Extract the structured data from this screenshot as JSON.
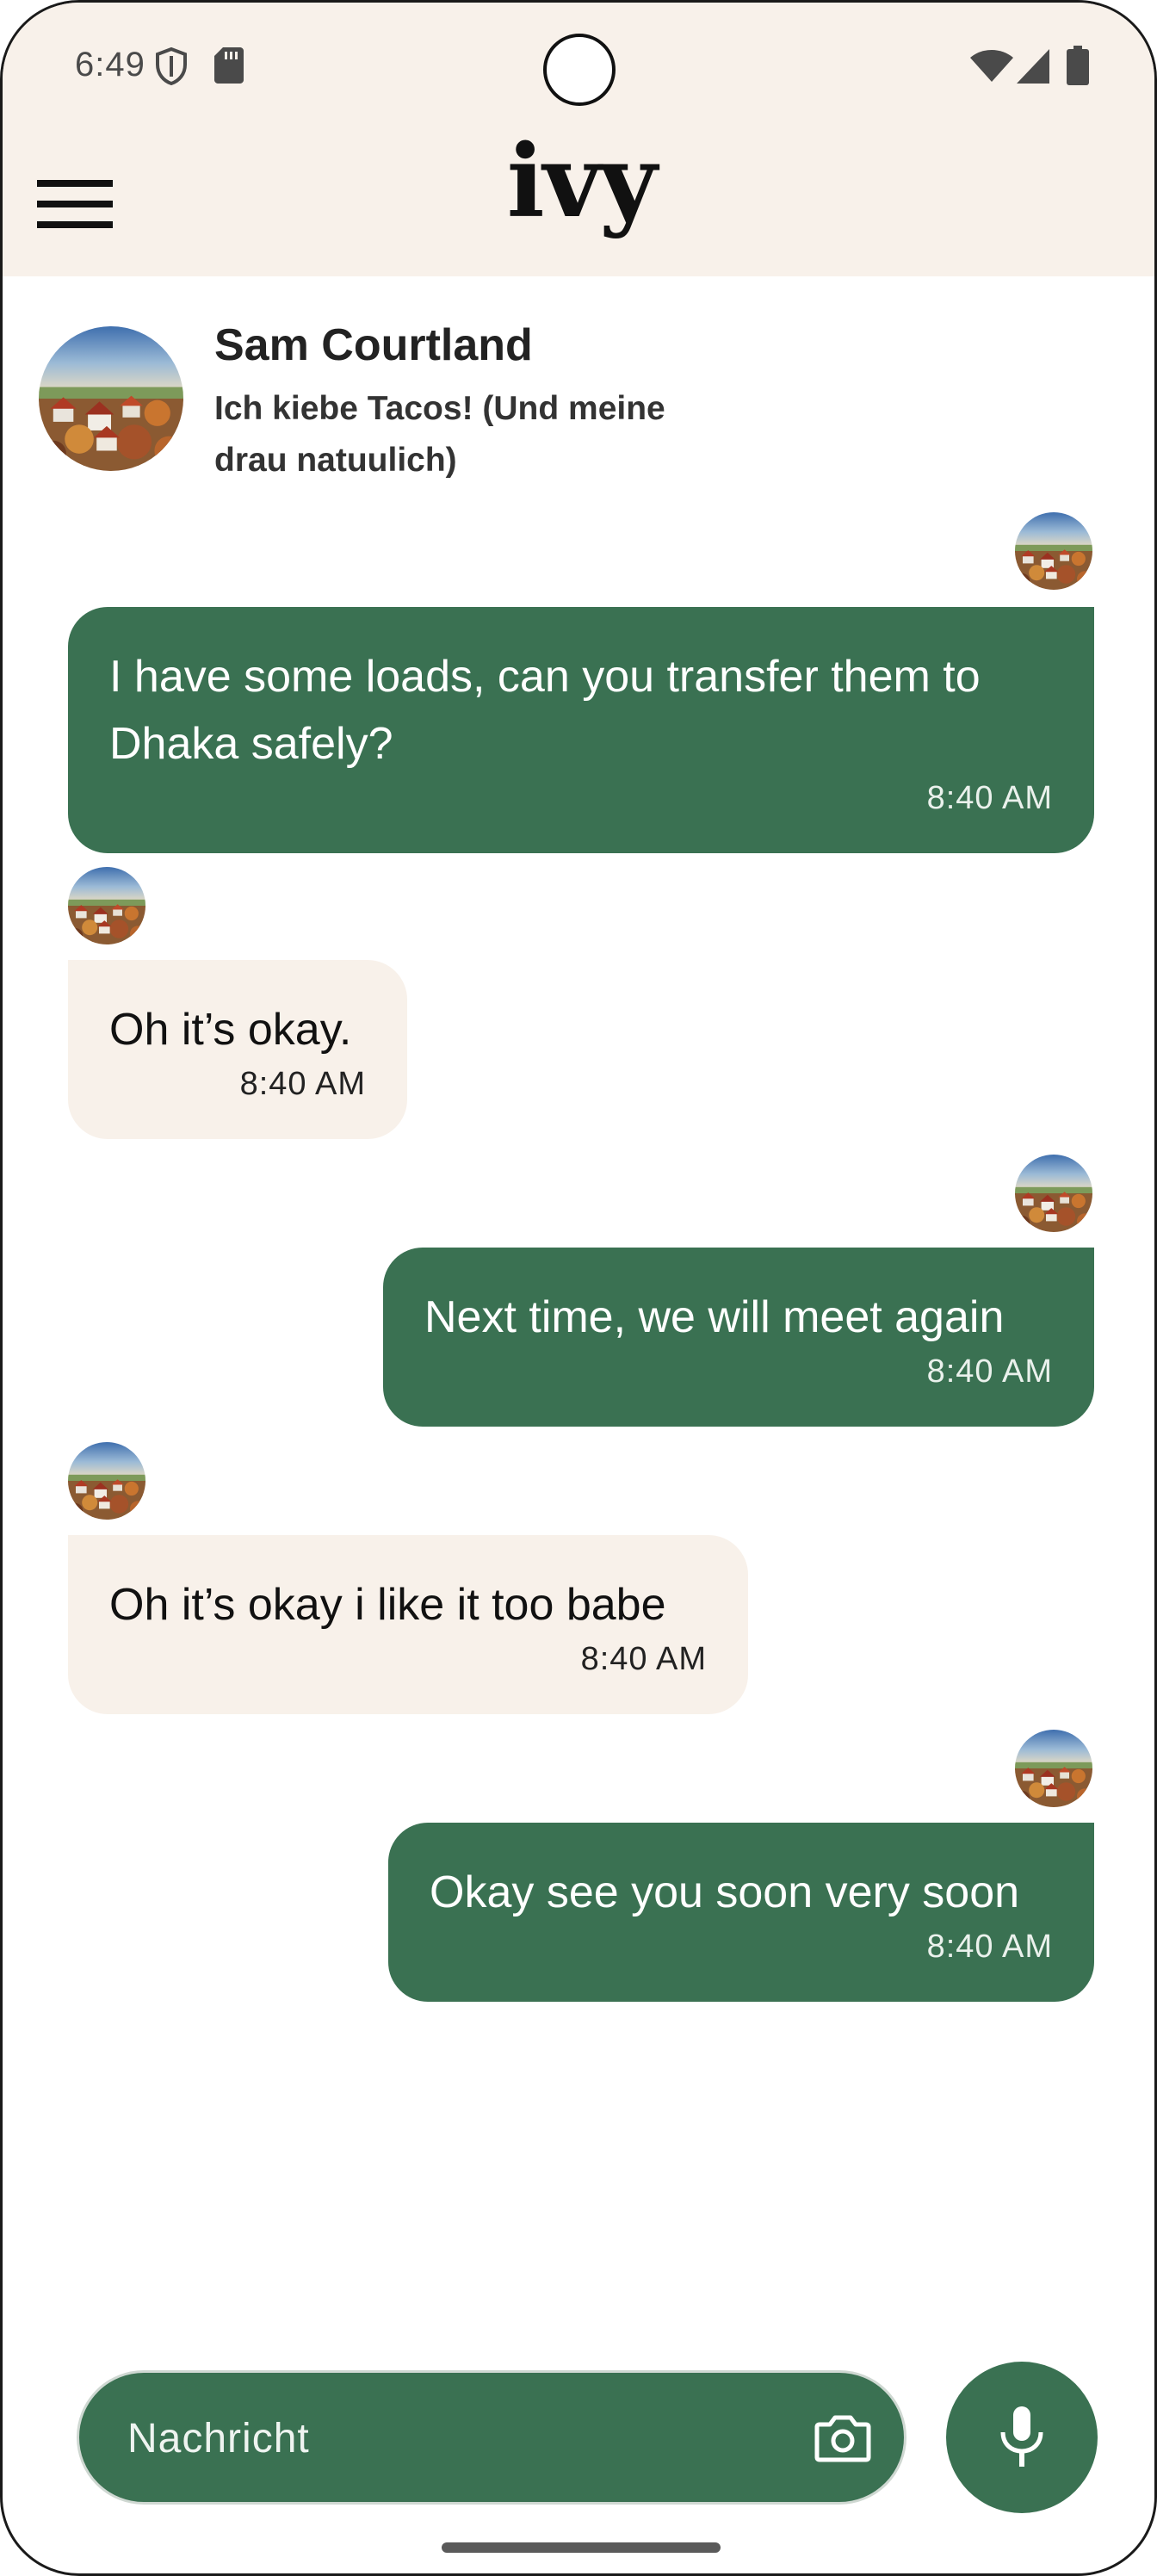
{
  "status_bar": {
    "time": "6:49",
    "icons": [
      "shield-icon",
      "sd-card-icon",
      "wifi-icon",
      "signal-icon",
      "battery-icon"
    ]
  },
  "app_bar": {
    "logo": "ivy",
    "menu_icon": "menu-icon"
  },
  "contact": {
    "name": "Sam Courtland",
    "status": "Ich kiebe Tacos! (Und meine drau natuulich)",
    "avatar": "landscape-avatar"
  },
  "messages": [
    {
      "direction": "outgoing",
      "text": "I have some loads, can you transfer them to\nDhaka safely?",
      "time": "8:40 AM"
    },
    {
      "direction": "incoming",
      "text": "Oh it’s okay.",
      "time": "8:40 AM"
    },
    {
      "direction": "outgoing",
      "text": "Next time, we will meet again",
      "time": "8:40 AM"
    },
    {
      "direction": "incoming",
      "text": "Oh it’s okay i like it too babe",
      "time": "8:40 AM"
    },
    {
      "direction": "outgoing",
      "text": "Okay see you soon very soon",
      "time": "8:40 AM"
    }
  ],
  "composer": {
    "placeholder": "Nachricht",
    "camera_icon": "camera-icon",
    "mic_icon": "microphone-icon"
  },
  "colors": {
    "accent": "#3a7152",
    "header_bg": "#f8f1ea",
    "incoming_bubble": "#f8f1ea",
    "outgoing_bubble": "#3a7152"
  }
}
